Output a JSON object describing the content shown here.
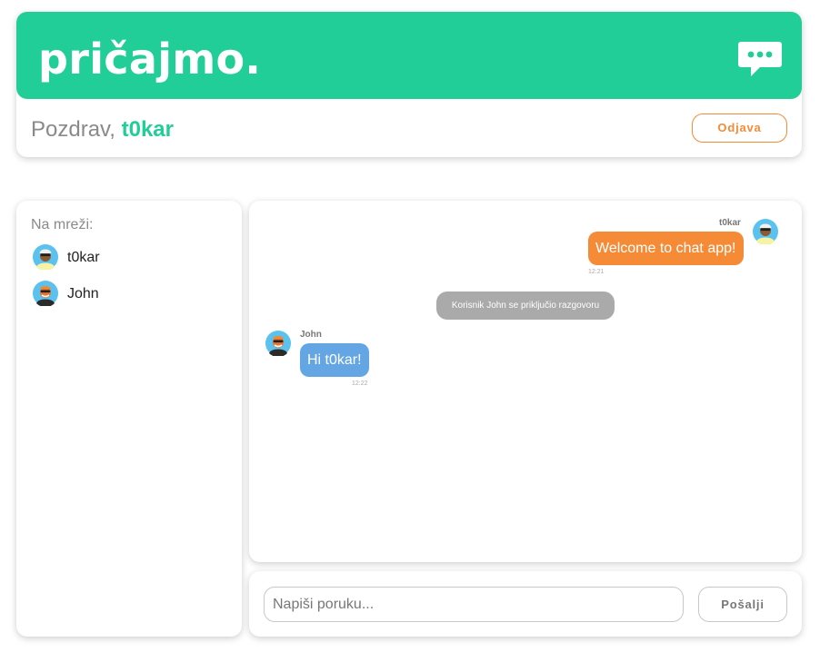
{
  "header": {
    "brand": "pričajmo.",
    "greeting_prefix": "Pozdrav, ",
    "username": "t0kar",
    "logout_label": "Odjava",
    "chat_icon": "chat-bubble-icon"
  },
  "online": {
    "title": "Na mreži:",
    "users": [
      {
        "name": "t0kar",
        "avatar": "avatar-icon"
      },
      {
        "name": "John",
        "avatar": "avatar-icon"
      }
    ]
  },
  "chat": {
    "messages": [
      {
        "sender": "t0kar",
        "text": "Welcome to chat app!",
        "time": "12:21",
        "direction": "outgoing"
      },
      {
        "system": "Korisnik John se priključio razgovoru"
      },
      {
        "sender": "John",
        "text": "Hi t0kar!",
        "time": "12:22",
        "direction": "incoming"
      }
    ]
  },
  "composer": {
    "placeholder": "Napiši poruku...",
    "value": "",
    "send_label": "Pošalji"
  },
  "colors": {
    "brand": "#21ce97",
    "outgoing_bubble": "#f58b37",
    "incoming_bubble": "#64a6e4",
    "system_bubble": "#aaaaaa"
  }
}
